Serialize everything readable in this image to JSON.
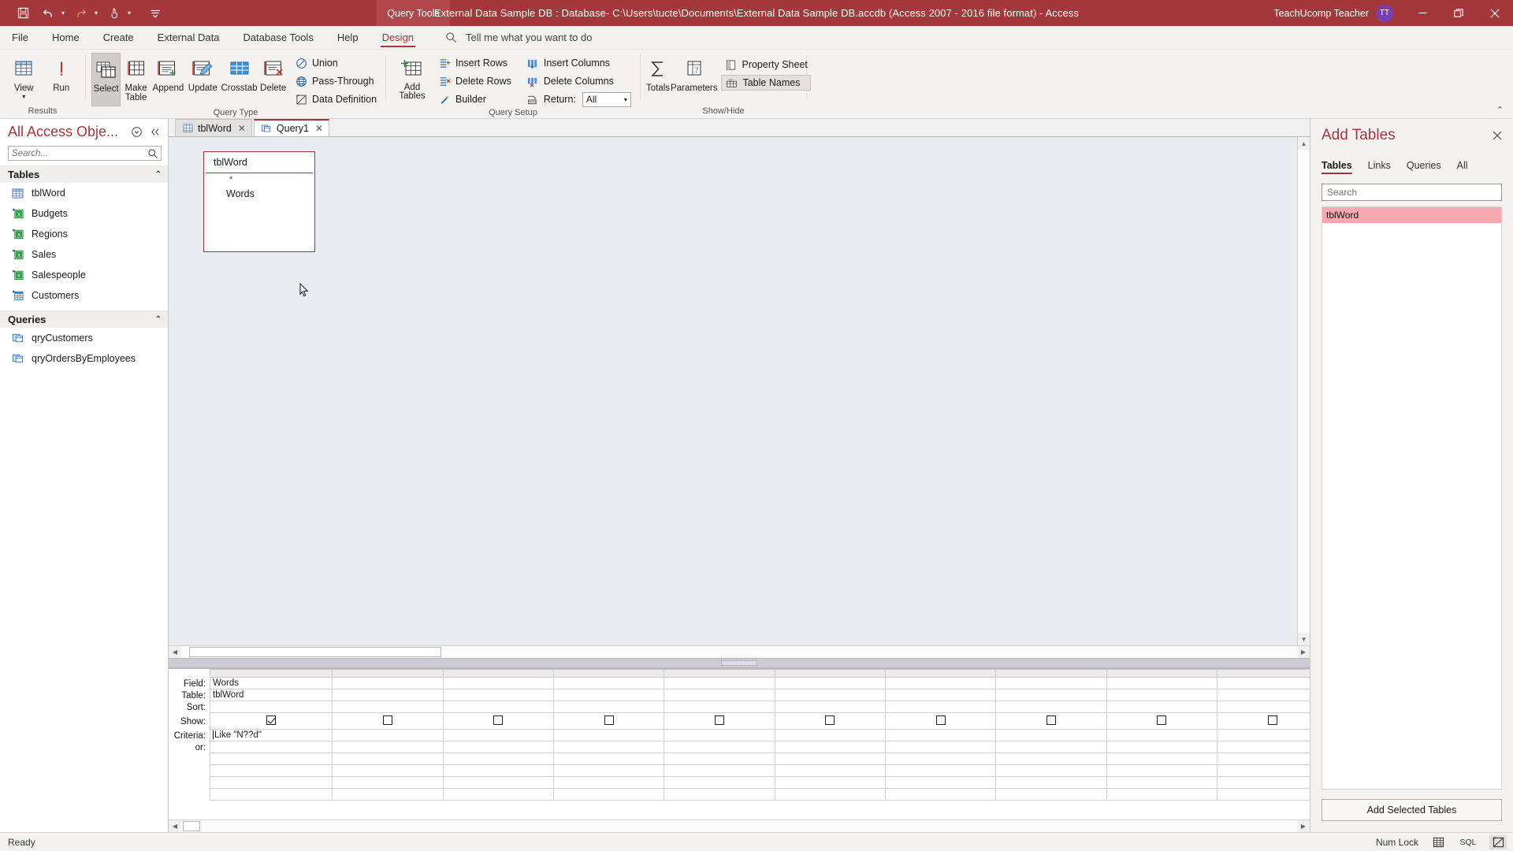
{
  "titlebar": {
    "window_title": "External Data Sample DB : Database- C:\\Users\\tucte\\Documents\\External Data Sample DB.accdb (Access 2007 - 2016 file format)  -  Access",
    "contextual_tab_label": "Query Tools",
    "account_name": "TeachUcomp Teacher",
    "avatar_initials": "TT",
    "qat": [
      {
        "name": "save-icon",
        "glyph": "὚B"
      },
      {
        "name": "undo-icon",
        "glyph": "↶"
      },
      {
        "name": "redo-icon",
        "glyph": "↷"
      },
      {
        "name": "touch-mode-icon",
        "glyph": "☝"
      },
      {
        "name": "customize-qat-icon",
        "glyph": "≡"
      }
    ],
    "window_buttons": {
      "minimize": "—",
      "restore": "❐",
      "close": "✕"
    }
  },
  "menubar": {
    "tabs": [
      {
        "label": "File",
        "active": false
      },
      {
        "label": "Home",
        "active": false
      },
      {
        "label": "Create",
        "active": false
      },
      {
        "label": "External Data",
        "active": false
      },
      {
        "label": "Database Tools",
        "active": false
      },
      {
        "label": "Help",
        "active": false
      },
      {
        "label": "Design",
        "active": true
      }
    ],
    "tellme_placeholder": "Tell me what you want to do"
  },
  "ribbon": {
    "collapse_glyph": "⌃",
    "groups": [
      {
        "label": "Results",
        "buttons": [
          {
            "label": "View",
            "name": "view-button",
            "has_menu": true
          },
          {
            "label": "Run",
            "name": "run-button",
            "has_menu": false
          }
        ]
      },
      {
        "label": "Query Type",
        "buttons": [
          {
            "label": "Select",
            "name": "select-query-button",
            "selected": true
          },
          {
            "label": "Make Table",
            "name": "make-table-query-button",
            "selected": false
          },
          {
            "label": "Append",
            "name": "append-query-button",
            "selected": false
          },
          {
            "label": "Update",
            "name": "update-query-button",
            "selected": false
          },
          {
            "label": "Crosstab",
            "name": "crosstab-query-button",
            "selected": false
          },
          {
            "label": "Delete",
            "name": "delete-query-button",
            "selected": false
          }
        ],
        "small_buttons": [
          {
            "label": "Union",
            "name": "union-query-button"
          },
          {
            "label": "Pass-Through",
            "name": "pass-through-query-button"
          },
          {
            "label": "Data Definition",
            "name": "data-definition-query-button"
          }
        ]
      },
      {
        "label": "Query Setup",
        "buttons": [
          {
            "label": "Add Tables",
            "name": "add-tables-button"
          }
        ],
        "small_buttons": [
          {
            "label": "Insert Rows",
            "name": "insert-rows-button"
          },
          {
            "label": "Delete Rows",
            "name": "delete-rows-button"
          },
          {
            "label": "Builder",
            "name": "builder-button"
          }
        ],
        "small_buttons2": [
          {
            "label": "Insert Columns",
            "name": "insert-columns-button"
          },
          {
            "label": "Delete Columns",
            "name": "delete-columns-button"
          }
        ],
        "return_label": "Return:",
        "return_value": "All"
      },
      {
        "label": "Show/Hide",
        "buttons": [
          {
            "label": "Totals",
            "name": "totals-button"
          },
          {
            "label": "Parameters",
            "name": "parameters-button"
          }
        ],
        "small_buttons": [
          {
            "label": "Property Sheet",
            "name": "property-sheet-button",
            "boxed": false
          },
          {
            "label": "Table Names",
            "name": "table-names-button",
            "boxed": true
          }
        ]
      }
    ]
  },
  "navpane": {
    "title": "All Access Obje...",
    "search_placeholder": "Search...",
    "groups": [
      {
        "name": "Tables",
        "items": [
          {
            "label": "tblWord",
            "icon": "table-icon"
          },
          {
            "label": "Budgets",
            "icon": "linked-excel-icon"
          },
          {
            "label": "Regions",
            "icon": "linked-excel-icon"
          },
          {
            "label": "Sales",
            "icon": "linked-excel-icon"
          },
          {
            "label": "Salespeople",
            "icon": "linked-excel-icon"
          },
          {
            "label": "Customers",
            "icon": "linked-table-icon"
          }
        ]
      },
      {
        "name": "Queries",
        "items": [
          {
            "label": "qryCustomers",
            "icon": "query-icon"
          },
          {
            "label": "qryOrdersByEmployees",
            "icon": "query-icon"
          }
        ]
      }
    ]
  },
  "document": {
    "tabs": [
      {
        "label": "tblWord",
        "icon": "table-icon",
        "active": false
      },
      {
        "label": "Query1",
        "icon": "query-icon",
        "active": true
      }
    ],
    "table_box": {
      "title": "tblWord",
      "fields": [
        "*",
        "Words"
      ]
    }
  },
  "qbe_grid": {
    "row_labels": [
      "Field:",
      "Table:",
      "Sort:",
      "Show:",
      "Criteria:",
      "or:"
    ],
    "columns": [
      {
        "field": "Words",
        "table": "tblWord",
        "sort": "",
        "show": true,
        "criteria": "Like \"N??d\"",
        "or": ""
      },
      {
        "field": "",
        "table": "",
        "sort": "",
        "show": false,
        "criteria": "",
        "or": ""
      },
      {
        "field": "",
        "table": "",
        "sort": "",
        "show": false,
        "criteria": "",
        "or": ""
      },
      {
        "field": "",
        "table": "",
        "sort": "",
        "show": false,
        "criteria": "",
        "or": ""
      },
      {
        "field": "",
        "table": "",
        "sort": "",
        "show": false,
        "criteria": "",
        "or": ""
      },
      {
        "field": "",
        "table": "",
        "sort": "",
        "show": false,
        "criteria": "",
        "or": ""
      },
      {
        "field": "",
        "table": "",
        "sort": "",
        "show": false,
        "criteria": "",
        "or": ""
      },
      {
        "field": "",
        "table": "",
        "sort": "",
        "show": false,
        "criteria": "",
        "or": ""
      },
      {
        "field": "",
        "table": "",
        "sort": "",
        "show": false,
        "criteria": "",
        "or": ""
      },
      {
        "field": "",
        "table": "",
        "sort": "",
        "show": false,
        "criteria": "",
        "or": ""
      },
      {
        "field": "",
        "table": "",
        "sort": "",
        "show": false,
        "criteria": "",
        "or": ""
      },
      {
        "field": "",
        "table": "",
        "sort": "",
        "show": false,
        "criteria": "",
        "or": ""
      }
    ],
    "empty_rows": 4
  },
  "taskpane": {
    "title": "Add Tables",
    "close_glyph": "✕",
    "tabs": [
      {
        "label": "Tables",
        "active": true
      },
      {
        "label": "Links",
        "active": false
      },
      {
        "label": "Queries",
        "active": false
      },
      {
        "label": "All",
        "active": false
      }
    ],
    "search_placeholder": "Search",
    "items": [
      {
        "label": "tblWord",
        "selected": true
      }
    ],
    "add_button_label": "Add Selected Tables"
  },
  "statusbar": {
    "message": "Ready",
    "num_lock": "Num Lock",
    "views": [
      {
        "name": "datasheet-view-button",
        "label": ""
      },
      {
        "name": "sql-view-button",
        "label": "SQL"
      },
      {
        "name": "design-view-button",
        "label": ""
      }
    ]
  },
  "colors": {
    "accent": "#a4373a",
    "titlebar": "#a4373a",
    "ribbon_bg": "#f3f2f1",
    "canvas_bg": "#e9edf0",
    "selection_pink": "#f7a8b0",
    "avatar": "#7a3faf"
  }
}
